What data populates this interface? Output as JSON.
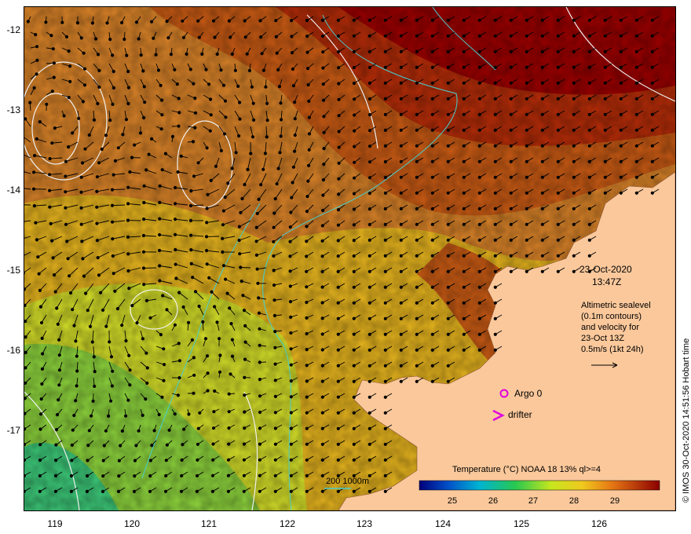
{
  "map": {
    "date": "23-Oct-2020",
    "time": "13:47Z",
    "legend_lines": [
      "Altimetric sealevel",
      "(0.1m contours)",
      "and velocity for",
      "23-Oct 13Z",
      "0.5m/s (1kt 24h)"
    ],
    "argo_label": "Argo 0",
    "drifter_label": "drifter",
    "bathy_label": "200  1000m",
    "colorbar_title": "Temperature (°C) NOAA 18 13% ql>=4",
    "colorbar_ticks": [
      "25",
      "26",
      "27",
      "28",
      "29"
    ],
    "credit": "© IMOS 30-Oct-2020 14:51:56 Hobart time",
    "y_ticks": [
      "-12",
      "-13",
      "-14",
      "-15",
      "-16",
      "-17"
    ],
    "x_ticks": [
      "119",
      "120",
      "121",
      "122",
      "123",
      "124",
      "125",
      "126"
    ],
    "colors": {
      "land": "#fac89b",
      "warm": "#9b0000",
      "mid": "#c8641e",
      "cool": "#e6c81e",
      "green": "#78c83c",
      "contour": "#48d0d0",
      "marker": "#e000e0"
    }
  }
}
